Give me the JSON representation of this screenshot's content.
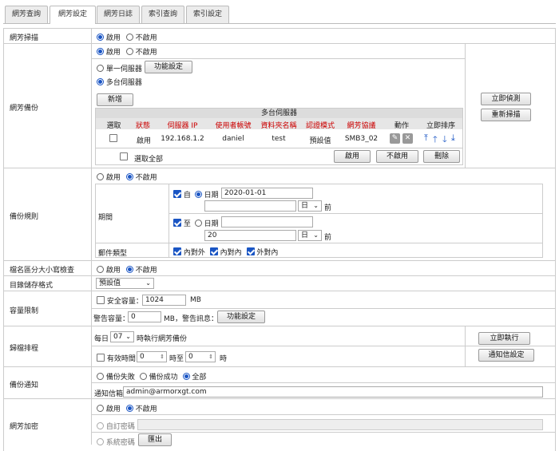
{
  "tabs": [
    "網芳查詢",
    "網芳設定",
    "網芳日誌",
    "索引查詢",
    "索引設定"
  ],
  "scan": {
    "label": "網芳掃描",
    "on": "啟用",
    "off": "不啟用"
  },
  "backup": {
    "label": "網芳備份",
    "on": "啟用",
    "off": "不啟用",
    "single": "單一伺服器",
    "func_btn": "功能設定",
    "multi": "多台伺服器",
    "add_btn": "新增",
    "table_title": "多台伺服器",
    "cols": [
      "選取",
      "狀態",
      "伺服器 IP",
      "使用者帳號",
      "資料夾名稱",
      "認證模式",
      "網芳協議",
      "動作",
      "立即排序"
    ],
    "row": {
      "status": "啟用",
      "ip": "192.168.1.2",
      "user": "daniel",
      "folder": "test",
      "auth": "預設值",
      "proto": "SMB3_02"
    },
    "select_all": "選取全部",
    "enable_btn": "啟用",
    "disable_btn": "不啟用",
    "delete_btn": "刪除",
    "detect_btn": "立即偵測",
    "rescan_btn": "重新掃描"
  },
  "rules": {
    "label": "備份規則",
    "on": "啟用",
    "off": "不啟用",
    "period": "期間",
    "from": "自",
    "to": "至",
    "date": "日期",
    "from_date": "2020-01-01",
    "to_days": "20",
    "day_unit": "日",
    "before": "前",
    "mail_type": "郵件類型",
    "mail_types": [
      "內對外",
      "內對內",
      "外對內"
    ]
  },
  "case_check": {
    "label": "檔名區分大小寫檢查",
    "on": "啟用",
    "off": "不啟用"
  },
  "dir_format": {
    "label": "目錄儲存格式",
    "value": "預設值"
  },
  "capacity": {
    "label": "容量限制",
    "safe": "安全容量：",
    "safe_val": "1024",
    "unit": "MB",
    "warn": "警告容量：",
    "warn_val": "0",
    "warn_msg": "MB，警告訊息：",
    "func_btn": "功能設定"
  },
  "schedule": {
    "label": "歸檔排程",
    "daily": "每日",
    "hour": "07",
    "exec": "時執行網芳備份",
    "valid": "有效時間",
    "start": "0",
    "mid": "時至",
    "end": "0",
    "end_unit": "時",
    "run_btn": "立即執行",
    "notify_btn": "通知信設定"
  },
  "notify": {
    "label": "備份通知",
    "fail": "備份失敗",
    "success": "備份成功",
    "all": "全部",
    "mailbox": "通知信箱",
    "email": "admin@armorxgt.com"
  },
  "encrypt": {
    "label": "網芳加密",
    "on": "啟用",
    "off": "不啟用",
    "custom": "自訂密碼",
    "system": "系統密碼",
    "export_btn": "匯出"
  }
}
